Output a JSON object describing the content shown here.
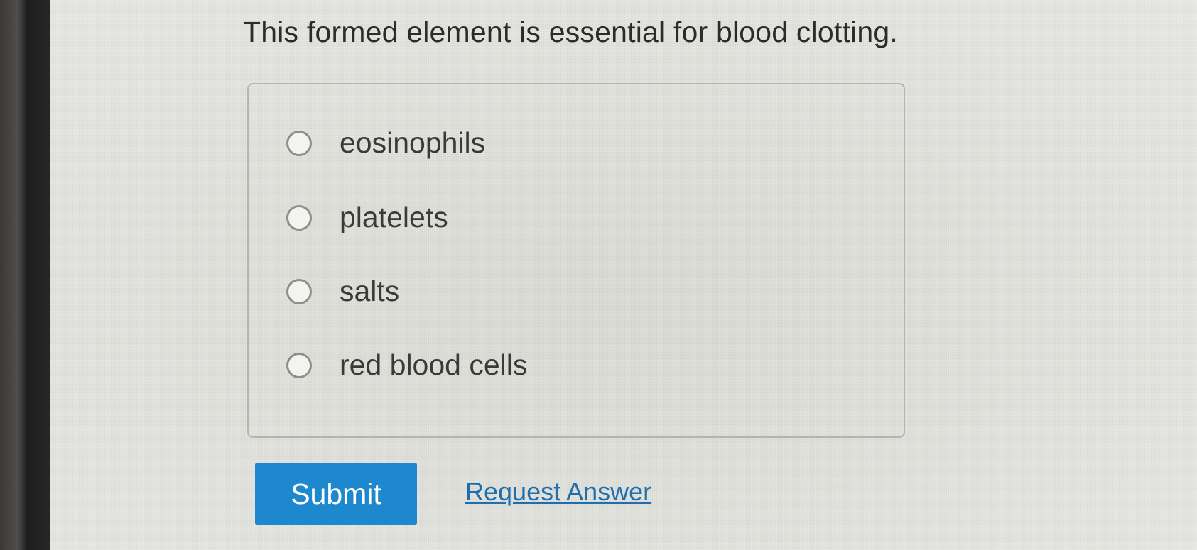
{
  "question": {
    "text": "This formed element is essential for blood clotting."
  },
  "choices": [
    {
      "label": "eosinophils",
      "selected": false
    },
    {
      "label": "platelets",
      "selected": false
    },
    {
      "label": "salts",
      "selected": false
    },
    {
      "label": "red blood cells",
      "selected": false
    }
  ],
  "actions": {
    "submit_label": "Submit",
    "request_answer_label": "Request Answer"
  },
  "colors": {
    "submit_button": "#1e88cf",
    "link": "#1f6fae"
  }
}
